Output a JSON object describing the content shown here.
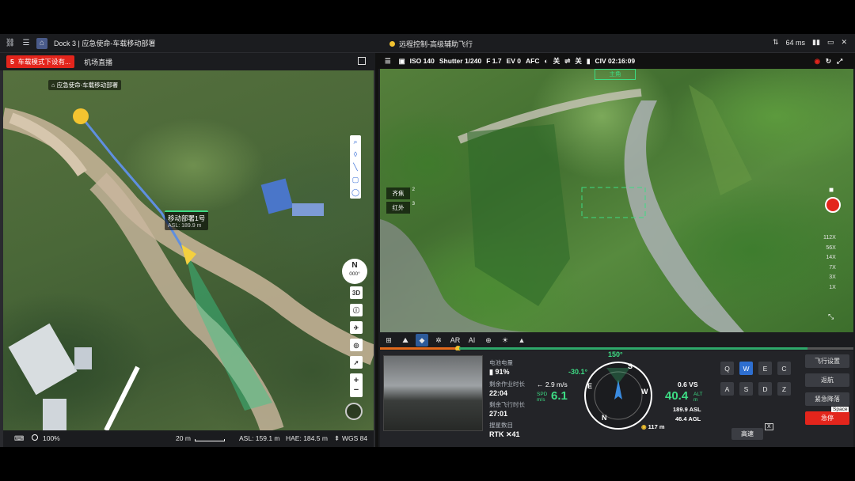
{
  "topbar": {
    "title": "Dock 3 | 应急使命-车载移动部署",
    "center_status": "远程控制-高级辅助飞行",
    "latency": "64 ms"
  },
  "left_panel": {
    "mode_tag": "车载模式下设有...",
    "tab_live": "机场直播",
    "mode_tag_number": "5",
    "map_dock_label": "应急使命-车载移动部署",
    "drone_label": "移动部署1号",
    "drone_asl": "ASL: 189.9 m",
    "compass_n": "N",
    "compass_deg": "000°",
    "btn_3d": "3D",
    "zoom_in": "+",
    "zoom_out": "−",
    "zoom_pct": "100%",
    "scale": "20 m",
    "asl": "ASL: 159.1 m",
    "hae": "HAE: 184.5 m",
    "datum": "WGS 84"
  },
  "camera_bar": {
    "iso": "ISO 140",
    "shutter": "Shutter 1/240",
    "fnum": "F 1.7",
    "ev": "EV 0",
    "focus": "AFC",
    "opt1": "关",
    "opt2": "关",
    "civ": "CIV 02:16:09"
  },
  "video": {
    "target_label": "主角",
    "lens_wide": "齐焦",
    "lens_ir": "红外",
    "lens_wide_n": "2",
    "lens_ir_n": "3",
    "zoom_levels": [
      "112X",
      "56X",
      "14X",
      "7X",
      "3X",
      "1X"
    ]
  },
  "telemetry": {
    "battery_label": "电池电量",
    "battery": "91%",
    "remain_label": "剩余作业时长",
    "remain": "22:04",
    "flight_label": "剩余飞行时长",
    "flight": "27:01",
    "search_label": "搜星数目",
    "rtk": "RTK",
    "rtk_count": "41",
    "heading": "150°",
    "yaw": "-30.1°",
    "hspeed": "← 2.9 m/s",
    "spd_label": "SPD m/s",
    "spd": "6.1",
    "vs": "0.6 VS",
    "alt_label": "ALT m",
    "alt": "40.4",
    "asl": "189.9 ASL",
    "agl": "46.4 AGL",
    "dist": "117 m",
    "compass_letters": [
      "N",
      "E",
      "S",
      "W"
    ]
  },
  "keys": {
    "row1": [
      "Q",
      "W",
      "E",
      "C"
    ],
    "row2": [
      "A",
      "S",
      "D",
      "Z"
    ],
    "high_speed": "高速",
    "x_badge": "X"
  },
  "actions": {
    "fly_settings": "飞行设置",
    "return": "返航",
    "emergency_land": "紧急降落",
    "space": "Space",
    "emergency_stop": "急停"
  },
  "colors": {
    "accent": "#2e6fd0",
    "danger": "#e3251c",
    "ok": "#3ddc84"
  }
}
